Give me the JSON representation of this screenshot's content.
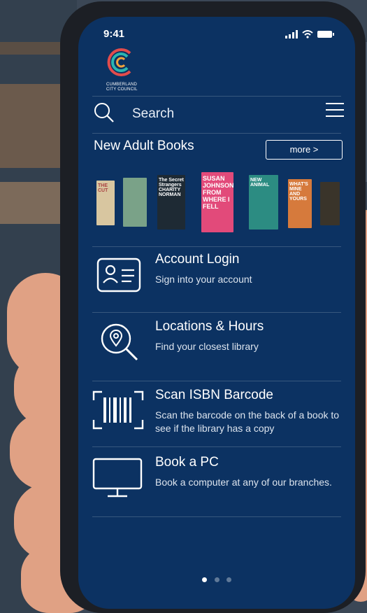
{
  "status_bar": {
    "time": "9:41"
  },
  "logo": {
    "name": "CUMBERLAND CITY COUNCIL"
  },
  "search": {
    "placeholder": "Search"
  },
  "new_books": {
    "title": "New Adult Books",
    "more_label": "more >",
    "covers": [
      {
        "title": "THE CUT",
        "color": "#d8c6a0"
      },
      {
        "title": "",
        "color": "#7aa288"
      },
      {
        "title": "The Secret Strangers CHARITY NORMAN",
        "color": "#1e2a34"
      },
      {
        "title": "SUSAN JOHNSON FROM WHERE I FELL",
        "color": "#e24a7a"
      },
      {
        "title": "NEW ANIMAL",
        "color": "#2c8c82"
      },
      {
        "title": "WHAT'S MINE AND YOURS",
        "color": "#d67a3c"
      },
      {
        "title": "",
        "color": "#3a342a"
      }
    ]
  },
  "menu": [
    {
      "icon": "id-card-icon",
      "title": "Account Login",
      "desc": "Sign into your account"
    },
    {
      "icon": "location-search-icon",
      "title": "Locations & Hours",
      "desc": "Find your closest library"
    },
    {
      "icon": "barcode-scan-icon",
      "title": "Scan ISBN Barcode",
      "desc": "Scan the barcode on the back of a book to see if the library has a copy"
    },
    {
      "icon": "monitor-icon",
      "title": "Book a PC",
      "desc": "Book a computer at any of our branches."
    }
  ],
  "pagination": {
    "pages": 3,
    "active": 1
  }
}
